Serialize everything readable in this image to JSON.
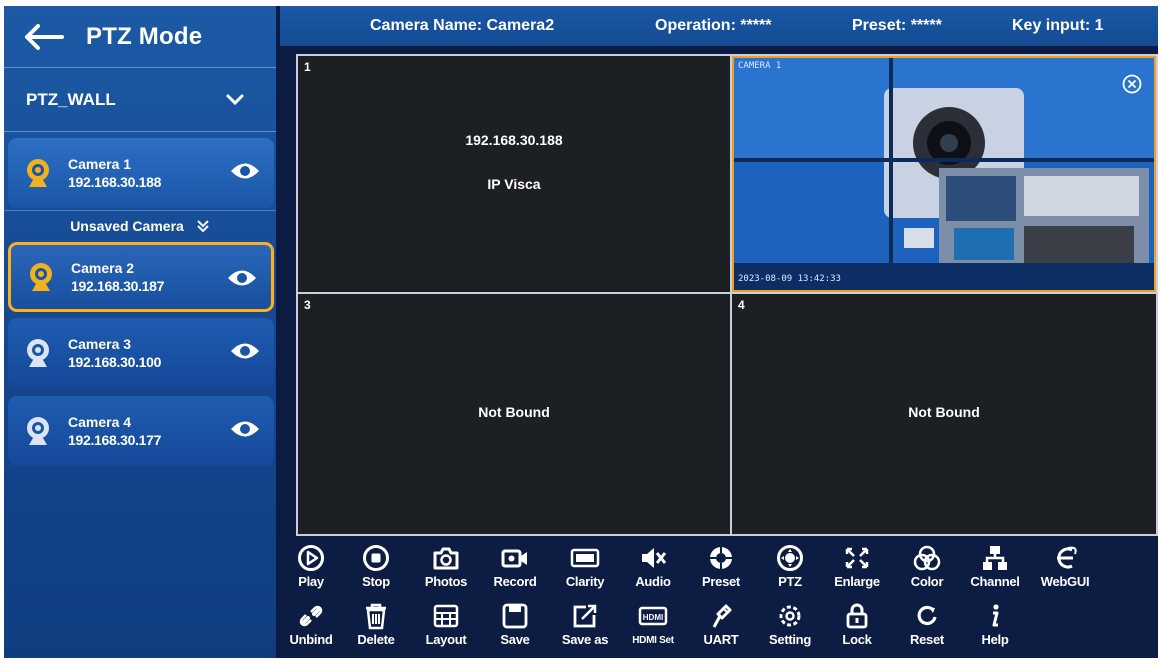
{
  "sidebar": {
    "title": "PTZ Mode",
    "wall_name": "PTZ_WALL",
    "unsaved_label": "Unsaved Camera",
    "cameras": [
      {
        "name": "Camera 1",
        "ip": "192.168.30.188",
        "selected": false
      },
      {
        "name": "Camera 2",
        "ip": "192.168.30.187",
        "selected": true
      },
      {
        "name": "Camera 3",
        "ip": "192.168.30.100",
        "selected": false
      },
      {
        "name": "Camera 4",
        "ip": "192.168.30.177",
        "selected": false
      }
    ]
  },
  "topbar": {
    "camera_name": "Camera Name: Camera2",
    "operation": "Operation: *****",
    "preset": "Preset: *****",
    "key_input": "Key input: 1"
  },
  "cells": [
    {
      "number": "1",
      "line1": "192.168.30.188",
      "line2": "IP Visca"
    },
    {
      "number": "",
      "osd_top": "CAMERA 1",
      "osd_bottom": "2023-08-09 13:42:33"
    },
    {
      "number": "3",
      "line1": "Not Bound"
    },
    {
      "number": "4",
      "line1": "Not Bound"
    }
  ],
  "toolbar": {
    "row1": [
      {
        "label": "Play",
        "icon": "play-icon"
      },
      {
        "label": "Stop",
        "icon": "stop-icon"
      },
      {
        "label": "Photos",
        "icon": "camera-icon"
      },
      {
        "label": "Record",
        "icon": "record-icon"
      },
      {
        "label": "Clarity",
        "icon": "clarity-icon"
      },
      {
        "label": "Audio",
        "icon": "audio-mute-icon"
      },
      {
        "label": "Preset",
        "icon": "preset-icon"
      },
      {
        "label": "PTZ",
        "icon": "ptz-icon"
      },
      {
        "label": "Enlarge",
        "icon": "enlarge-icon"
      },
      {
        "label": "Color",
        "icon": "color-icon"
      },
      {
        "label": "Channel",
        "icon": "channel-icon"
      },
      {
        "label": "WebGUI",
        "icon": "web-icon"
      }
    ],
    "row2": [
      {
        "label": "Unbind",
        "icon": "unbind-icon"
      },
      {
        "label": "Delete",
        "icon": "trash-icon"
      },
      {
        "label": "Layout",
        "icon": "layout-icon"
      },
      {
        "label": "Save",
        "icon": "save-icon"
      },
      {
        "label": "Save as",
        "icon": "save-as-icon"
      },
      {
        "label": "HDMI Set",
        "icon": "hdmi-icon"
      },
      {
        "label": "UART",
        "icon": "uart-icon"
      },
      {
        "label": "Setting",
        "icon": "gear-icon"
      },
      {
        "label": "Lock",
        "icon": "lock-icon"
      },
      {
        "label": "Reset",
        "icon": "reset-icon"
      },
      {
        "label": "Help",
        "icon": "info-icon"
      }
    ]
  },
  "colors": {
    "sidebar_blue": "#1c5aa6",
    "selected_border": "#ffae1e",
    "camera_icon_active": "#f2b21b",
    "camera_icon_inactive": "#d9e4f5",
    "cell_background": "#1c1f24"
  }
}
